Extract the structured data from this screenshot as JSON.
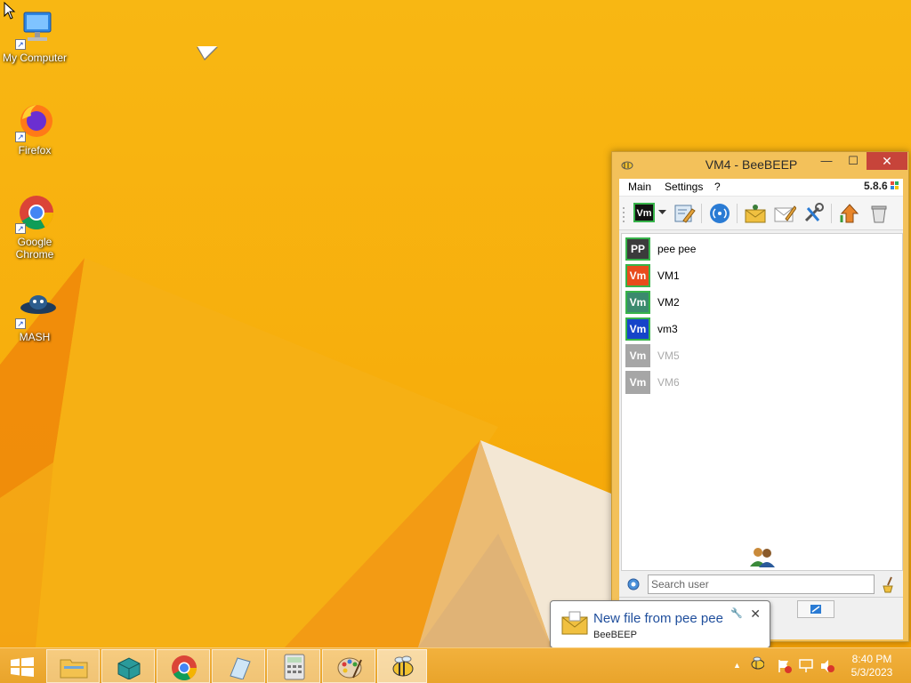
{
  "desktop": {
    "icons": [
      {
        "label": "My Computer",
        "icon": "computer-icon"
      },
      {
        "label": "Firefox",
        "icon": "firefox-icon"
      },
      {
        "label": "Google Chrome",
        "icon": "chrome-icon"
      },
      {
        "label": "MASH",
        "icon": "mash-icon"
      }
    ]
  },
  "window": {
    "title": "VM4 - BeeBEEP",
    "min_glyph": "—",
    "max_glyph": "☐",
    "close_glyph": "✕",
    "menu": [
      "Main",
      "Settings",
      "?"
    ],
    "version": "5.8.6",
    "status_badge": "Vm",
    "users": [
      {
        "initials": "PP",
        "name": "pee pee",
        "bg": "#3b3b3b",
        "border": "#37b34a",
        "online": true
      },
      {
        "initials": "Vm",
        "name": "VM1",
        "bg": "#e84c1c",
        "border": "#37b34a",
        "online": true
      },
      {
        "initials": "Vm",
        "name": "VM2",
        "bg": "#3b8a6e",
        "border": "#37b34a",
        "online": true
      },
      {
        "initials": "Vm",
        "name": "vm3",
        "bg": "#1544c9",
        "border": "#37b34a",
        "online": true
      },
      {
        "initials": "Vm",
        "name": "VM5",
        "bg": "#a6a6a6",
        "border": "#a6a6a6",
        "online": false
      },
      {
        "initials": "Vm",
        "name": "VM6",
        "bg": "#a6a6a6",
        "border": "#a6a6a6",
        "online": false
      }
    ],
    "search_placeholder": "Search user",
    "tab_count": "1"
  },
  "notification": {
    "title": "New file from pee pee",
    "source": "BeeBEEP",
    "close_glyph": "✕",
    "settings_glyph": "🔧"
  },
  "taskbar": {
    "time": "8:40 PM",
    "date": "5/3/2023",
    "tray_up_glyph": "▲"
  }
}
